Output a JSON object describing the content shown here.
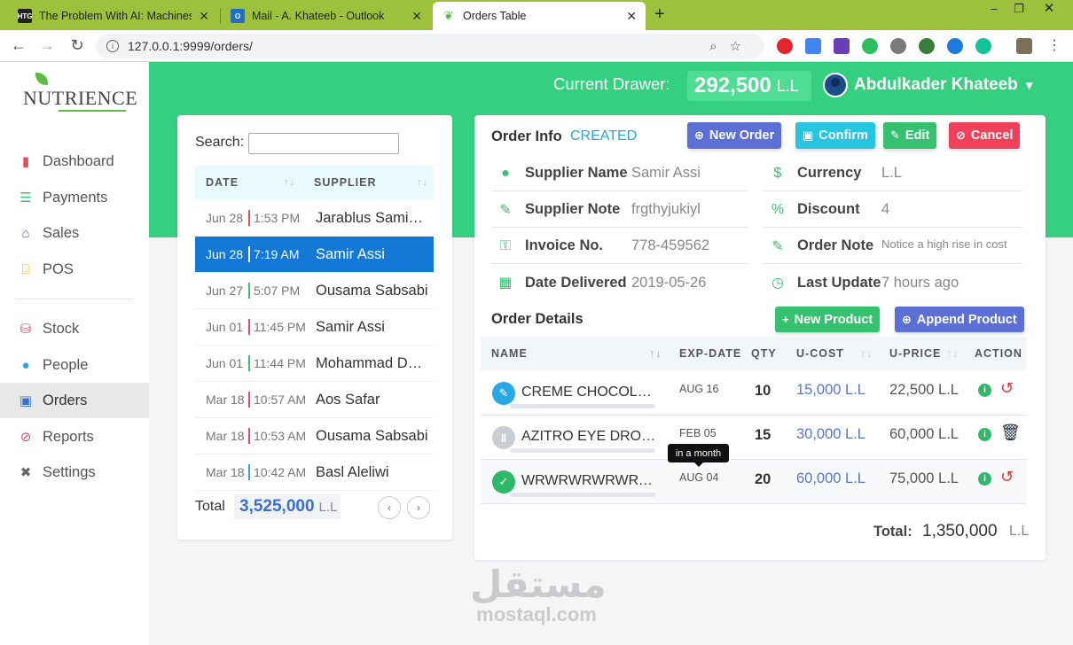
{
  "browser": {
    "tabs": [
      {
        "title": "The Problem With AI: Machines A",
        "favicon_label": "HTG"
      },
      {
        "title": "Mail - A. Khateeb - Outlook",
        "favicon_label": "O"
      },
      {
        "title": "Orders Table",
        "favicon_label": ""
      }
    ],
    "url": "127.0.0.1:9999/orders/"
  },
  "sidebar": {
    "brand": "NUTRIENCE",
    "items": [
      {
        "label": "Dashboard",
        "icon": "bar-chart-icon",
        "color": "#e84a5f"
      },
      {
        "label": "Payments",
        "icon": "list-icon",
        "color": "#35c16f"
      },
      {
        "label": "Sales",
        "icon": "basket-icon",
        "color": "#3b6fd1"
      },
      {
        "label": "POS",
        "icon": "store-icon",
        "color": "#f2b233"
      },
      {
        "label": "Stock",
        "icon": "stock-icon",
        "color": "#e84a5f"
      },
      {
        "label": "People",
        "icon": "person-icon",
        "color": "#2fa3e6"
      },
      {
        "label": "Orders",
        "icon": "orders-icon",
        "color": "#3b6fd1"
      },
      {
        "label": "Reports",
        "icon": "compass-icon",
        "color": "#e84a5f"
      },
      {
        "label": "Settings",
        "icon": "tools-icon",
        "color": "#666"
      }
    ]
  },
  "header": {
    "drawer_label": "Current Drawer:",
    "drawer_amount": "292,500",
    "drawer_currency": "L.L",
    "user_name": "Abdulkader Khateeb"
  },
  "orders_list": {
    "search_label": "Search:",
    "search_value": "",
    "columns": [
      "DATE",
      "SUPPLIER"
    ],
    "rows": [
      {
        "date": "Jun 28",
        "time": "1:53 PM",
        "supplier": "Jarablus Samiskaaa",
        "bar_color": "#e84a5f"
      },
      {
        "date": "Jun 28",
        "time": "7:19 AM",
        "supplier": "Samir Assi",
        "bar_color": "#ffffff"
      },
      {
        "date": "Jun 27",
        "time": "5:07 PM",
        "supplier": "Ousama Sabsabi",
        "bar_color": "#35c16f"
      },
      {
        "date": "Jun 01",
        "time": "11:45 PM",
        "supplier": "Samir Assi",
        "bar_color": "#e84a5f"
      },
      {
        "date": "Jun 01",
        "time": "11:44 PM",
        "supplier": "Mohammad Darwish",
        "bar_color": "#35c16f"
      },
      {
        "date": "Mar 18",
        "time": "10:57 AM",
        "supplier": "Aos Safar",
        "bar_color": "#e84a5f"
      },
      {
        "date": "Mar 18",
        "time": "10:53 AM",
        "supplier": "Ousama Sabsabi",
        "bar_color": "#e84a5f"
      },
      {
        "date": "Mar 18",
        "time": "10:42 AM",
        "supplier": "Basl Aleliwi",
        "bar_color": "#2fa3e6"
      }
    ],
    "selected_index": 1,
    "total_label": "Total",
    "total_amount": "3,525,000",
    "total_currency": "L.L",
    "prev": "‹",
    "next": "›"
  },
  "order_info": {
    "title": "Order Info",
    "status": "CREATED",
    "buttons": {
      "new_order": "New Order",
      "confirm": "Confirm",
      "edit": "Edit",
      "cancel": "Cancel"
    },
    "colors": {
      "new_order": "#5b6fd6",
      "confirm": "#26c6e0",
      "edit": "#35c16f",
      "cancel": "#f0405a"
    },
    "fields": {
      "supplier_name_label": "Supplier Name",
      "supplier_name": "Samir Assi",
      "supplier_note_label": "Supplier Note",
      "supplier_note": "frgthyjukiyl",
      "invoice_label": "Invoice No.",
      "invoice": "778-459562",
      "date_delivered_label": "Date Delivered",
      "date_delivered": "2019-05-26",
      "currency_label": "Currency",
      "currency": "L.L",
      "discount_label": "Discount",
      "discount": "4",
      "order_note_label": "Order Note",
      "order_note": "Notice a high rise in cost",
      "last_update_label": "Last Update",
      "last_update": "7 hours ago"
    }
  },
  "order_details": {
    "title": "Order Details",
    "new_product": "New Product",
    "append_product": "Append Product",
    "columns": {
      "name": "NAME",
      "exp": "EXP-DATE",
      "qty": "QTY",
      "ucost": "U-COST",
      "uprice": "U-PRICE",
      "action": "ACTION"
    },
    "rows": [
      {
        "name": "CREME CHOCOLATE",
        "exp": "AUG 16",
        "qty": "10",
        "ucost": "15,000 L.L",
        "uprice": "22,500 L.L",
        "icon": "edit-icon",
        "icon_color": "#26a8e6",
        "action": "undo-icon"
      },
      {
        "name": "AZITRO EYE DROPS",
        "exp": "FEB 05",
        "qty": "15",
        "ucost": "30,000 L.L",
        "uprice": "60,000 L.L",
        "icon": "pause-icon",
        "icon_color": "#c8cdd3",
        "action": "trash-icon"
      },
      {
        "name": "WRWRWRWRWRWR",
        "exp": "AUG 04",
        "qty": "20",
        "ucost": "60,000 L.L",
        "uprice": "75,000 L.L",
        "icon": "check-icon",
        "icon_color": "#2db968",
        "action": "undo-icon"
      }
    ],
    "tooltip": "in a month",
    "total_label": "Total:",
    "total_amount": "1,350,000",
    "total_currency": "L.L"
  },
  "watermark": {
    "arabic": "مستقل",
    "latin": "mostaql.com"
  }
}
